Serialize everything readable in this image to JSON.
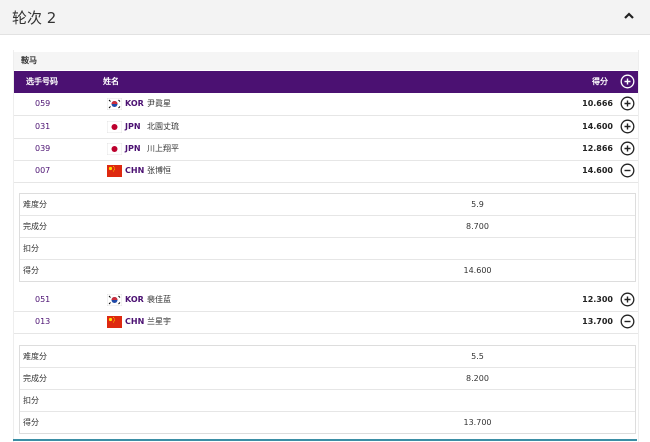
{
  "round": {
    "title": "轮次 2"
  },
  "app_label": "鞍马",
  "columns": {
    "bib": "选手号码",
    "name": "姓名",
    "score": "得分"
  },
  "colors": {
    "header_purple": "#4b1172",
    "text_purple": "#4b1172",
    "accent_line": "#3b8ea5"
  },
  "athletes": [
    {
      "bib": "059",
      "noc": "KOR",
      "name": "尹眞星",
      "score": "10.666",
      "expanded": false,
      "flag": "korea-flag"
    },
    {
      "bib": "031",
      "noc": "JPN",
      "name": "北園丈琉",
      "score": "14.600",
      "expanded": false,
      "flag": "japan-flag"
    },
    {
      "bib": "039",
      "noc": "JPN",
      "name": "川上翔平",
      "score": "12.866",
      "expanded": false,
      "flag": "japan-flag"
    },
    {
      "bib": "007",
      "noc": "CHN",
      "name": "张博恒",
      "score": "14.600",
      "expanded": true,
      "flag": "china-flag"
    },
    {
      "bib": "051",
      "noc": "KOR",
      "name": "裴佳蓝",
      "score": "12.300",
      "expanded": false,
      "flag": "korea-flag"
    },
    {
      "bib": "013",
      "noc": "CHN",
      "name": "兰星宇",
      "score": "13.700",
      "expanded": true,
      "flag": "china-flag"
    }
  ],
  "details": [
    {
      "rows": [
        {
          "label": "难度分",
          "value": "5.9"
        },
        {
          "label": "完成分",
          "value": "8.700"
        },
        {
          "label": "扣分",
          "value": ""
        },
        {
          "label": "得分",
          "value": "14.600"
        }
      ]
    },
    {
      "rows": [
        {
          "label": "难度分",
          "value": "5.5"
        },
        {
          "label": "完成分",
          "value": "8.200"
        },
        {
          "label": "扣分",
          "value": ""
        },
        {
          "label": "得分",
          "value": "13.700"
        }
      ]
    }
  ]
}
